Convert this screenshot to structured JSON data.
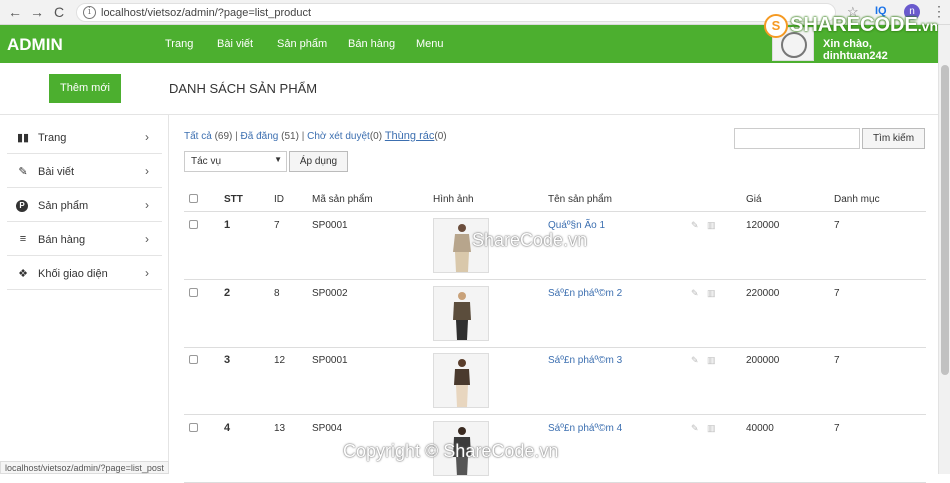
{
  "browser": {
    "url": "localhost/vietsoz/admin/?page=list_product",
    "back": "←",
    "forward": "→",
    "reload": "C",
    "star": "☆",
    "ext": "IQ",
    "profile": "n",
    "menu": "⋮"
  },
  "watermark_logo": {
    "badge": "S",
    "text": "SHARECODE",
    "suffix": ".vn"
  },
  "topnav": {
    "brand": "ADMIN",
    "items": [
      "Trang",
      "Bài viết",
      "Sản phẩm",
      "Bán hàng",
      "Menu"
    ],
    "greeting": "Xin chào, dinhtuan242"
  },
  "subheader": {
    "add_button": "Thêm mới",
    "title": "DANH SÁCH SẢN PHẨM"
  },
  "sidebar": {
    "items": [
      {
        "icon": "map-icon",
        "glyph": "▮▮",
        "label": "Trang"
      },
      {
        "icon": "edit-icon",
        "glyph": "✎",
        "label": "Bài viết"
      },
      {
        "icon": "product-icon",
        "glyph": "P",
        "label": "Sản phẩm"
      },
      {
        "icon": "database-icon",
        "glyph": "≡",
        "label": "Bán hàng"
      },
      {
        "icon": "cubes-icon",
        "glyph": "❖",
        "label": "Khối giao diện"
      }
    ],
    "chevron": "›"
  },
  "status_url": "localhost/vietsoz/admin/?page=list_post",
  "filters": {
    "all": "Tất cả",
    "all_count": "(69)",
    "published": "Đã đăng",
    "published_count": "(51)",
    "pending": "Chờ xét duyệt",
    "pending_count": "(0)",
    "trash": "Thùng rác",
    "trash_count": "(0)",
    "sep": "|"
  },
  "search": {
    "placeholder": "",
    "button": "Tìm kiếm"
  },
  "bulk": {
    "selected": "Tác vụ",
    "apply": "Áp dụng"
  },
  "table": {
    "columns": [
      "STT",
      "ID",
      "Mã sản phẩm",
      "Hình ảnh",
      "Tên sản phẩm",
      "Giá",
      "Danh mục"
    ],
    "rows": [
      {
        "stt": "1",
        "id": "7",
        "code": "SP0001",
        "name": "Quáº§n Ão 1",
        "price": "120000",
        "category": "7",
        "coat": "#b7a58c",
        "pants": "#d9c8ab"
      },
      {
        "stt": "2",
        "id": "8",
        "code": "SP0002",
        "name": "Sáº£n pháº©m 2",
        "price": "220000",
        "category": "7",
        "coat": "#5b4d3c",
        "pants": "#2f2f2f"
      },
      {
        "stt": "3",
        "id": "12",
        "code": "SP0001",
        "name": "Sáº£n pháº©m 3",
        "price": "200000",
        "category": "7",
        "coat": "#4a3a2e",
        "pants": "#e8d6bf"
      },
      {
        "stt": "4",
        "id": "13",
        "code": "SP004",
        "name": "Sáº£n pháº©m 4",
        "price": "40000",
        "category": "7",
        "coat": "#3b3b3b",
        "pants": "#555555"
      }
    ],
    "edit_icon": "✎",
    "delete_icon": "🗑"
  },
  "watermarks": [
    "ShareCode.vn",
    "Copyright © ShareCode.vn"
  ],
  "colors": {
    "primary": "#4caf2f",
    "link": "#3c6fb0"
  }
}
